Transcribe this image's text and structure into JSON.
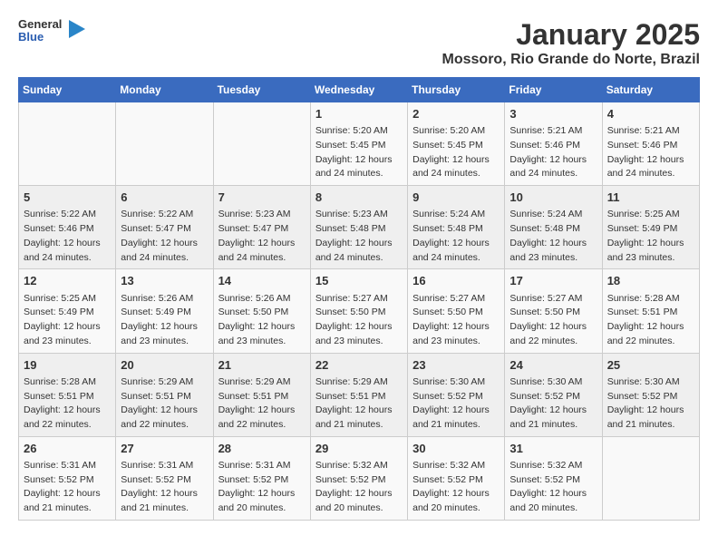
{
  "header": {
    "logo": {
      "general": "General",
      "blue": "Blue"
    },
    "title": "January 2025",
    "location": "Mossoro, Rio Grande do Norte, Brazil"
  },
  "days_of_week": [
    "Sunday",
    "Monday",
    "Tuesday",
    "Wednesday",
    "Thursday",
    "Friday",
    "Saturday"
  ],
  "weeks": [
    [
      {
        "day": "",
        "sunrise": "",
        "sunset": "",
        "daylight": ""
      },
      {
        "day": "",
        "sunrise": "",
        "sunset": "",
        "daylight": ""
      },
      {
        "day": "",
        "sunrise": "",
        "sunset": "",
        "daylight": ""
      },
      {
        "day": "1",
        "sunrise": "Sunrise: 5:20 AM",
        "sunset": "Sunset: 5:45 PM",
        "daylight": "Daylight: 12 hours and 24 minutes."
      },
      {
        "day": "2",
        "sunrise": "Sunrise: 5:20 AM",
        "sunset": "Sunset: 5:45 PM",
        "daylight": "Daylight: 12 hours and 24 minutes."
      },
      {
        "day": "3",
        "sunrise": "Sunrise: 5:21 AM",
        "sunset": "Sunset: 5:46 PM",
        "daylight": "Daylight: 12 hours and 24 minutes."
      },
      {
        "day": "4",
        "sunrise": "Sunrise: 5:21 AM",
        "sunset": "Sunset: 5:46 PM",
        "daylight": "Daylight: 12 hours and 24 minutes."
      }
    ],
    [
      {
        "day": "5",
        "sunrise": "Sunrise: 5:22 AM",
        "sunset": "Sunset: 5:46 PM",
        "daylight": "Daylight: 12 hours and 24 minutes."
      },
      {
        "day": "6",
        "sunrise": "Sunrise: 5:22 AM",
        "sunset": "Sunset: 5:47 PM",
        "daylight": "Daylight: 12 hours and 24 minutes."
      },
      {
        "day": "7",
        "sunrise": "Sunrise: 5:23 AM",
        "sunset": "Sunset: 5:47 PM",
        "daylight": "Daylight: 12 hours and 24 minutes."
      },
      {
        "day": "8",
        "sunrise": "Sunrise: 5:23 AM",
        "sunset": "Sunset: 5:48 PM",
        "daylight": "Daylight: 12 hours and 24 minutes."
      },
      {
        "day": "9",
        "sunrise": "Sunrise: 5:24 AM",
        "sunset": "Sunset: 5:48 PM",
        "daylight": "Daylight: 12 hours and 24 minutes."
      },
      {
        "day": "10",
        "sunrise": "Sunrise: 5:24 AM",
        "sunset": "Sunset: 5:48 PM",
        "daylight": "Daylight: 12 hours and 23 minutes."
      },
      {
        "day": "11",
        "sunrise": "Sunrise: 5:25 AM",
        "sunset": "Sunset: 5:49 PM",
        "daylight": "Daylight: 12 hours and 23 minutes."
      }
    ],
    [
      {
        "day": "12",
        "sunrise": "Sunrise: 5:25 AM",
        "sunset": "Sunset: 5:49 PM",
        "daylight": "Daylight: 12 hours and 23 minutes."
      },
      {
        "day": "13",
        "sunrise": "Sunrise: 5:26 AM",
        "sunset": "Sunset: 5:49 PM",
        "daylight": "Daylight: 12 hours and 23 minutes."
      },
      {
        "day": "14",
        "sunrise": "Sunrise: 5:26 AM",
        "sunset": "Sunset: 5:50 PM",
        "daylight": "Daylight: 12 hours and 23 minutes."
      },
      {
        "day": "15",
        "sunrise": "Sunrise: 5:27 AM",
        "sunset": "Sunset: 5:50 PM",
        "daylight": "Daylight: 12 hours and 23 minutes."
      },
      {
        "day": "16",
        "sunrise": "Sunrise: 5:27 AM",
        "sunset": "Sunset: 5:50 PM",
        "daylight": "Daylight: 12 hours and 23 minutes."
      },
      {
        "day": "17",
        "sunrise": "Sunrise: 5:27 AM",
        "sunset": "Sunset: 5:50 PM",
        "daylight": "Daylight: 12 hours and 22 minutes."
      },
      {
        "day": "18",
        "sunrise": "Sunrise: 5:28 AM",
        "sunset": "Sunset: 5:51 PM",
        "daylight": "Daylight: 12 hours and 22 minutes."
      }
    ],
    [
      {
        "day": "19",
        "sunrise": "Sunrise: 5:28 AM",
        "sunset": "Sunset: 5:51 PM",
        "daylight": "Daylight: 12 hours and 22 minutes."
      },
      {
        "day": "20",
        "sunrise": "Sunrise: 5:29 AM",
        "sunset": "Sunset: 5:51 PM",
        "daylight": "Daylight: 12 hours and 22 minutes."
      },
      {
        "day": "21",
        "sunrise": "Sunrise: 5:29 AM",
        "sunset": "Sunset: 5:51 PM",
        "daylight": "Daylight: 12 hours and 22 minutes."
      },
      {
        "day": "22",
        "sunrise": "Sunrise: 5:29 AM",
        "sunset": "Sunset: 5:51 PM",
        "daylight": "Daylight: 12 hours and 21 minutes."
      },
      {
        "day": "23",
        "sunrise": "Sunrise: 5:30 AM",
        "sunset": "Sunset: 5:52 PM",
        "daylight": "Daylight: 12 hours and 21 minutes."
      },
      {
        "day": "24",
        "sunrise": "Sunrise: 5:30 AM",
        "sunset": "Sunset: 5:52 PM",
        "daylight": "Daylight: 12 hours and 21 minutes."
      },
      {
        "day": "25",
        "sunrise": "Sunrise: 5:30 AM",
        "sunset": "Sunset: 5:52 PM",
        "daylight": "Daylight: 12 hours and 21 minutes."
      }
    ],
    [
      {
        "day": "26",
        "sunrise": "Sunrise: 5:31 AM",
        "sunset": "Sunset: 5:52 PM",
        "daylight": "Daylight: 12 hours and 21 minutes."
      },
      {
        "day": "27",
        "sunrise": "Sunrise: 5:31 AM",
        "sunset": "Sunset: 5:52 PM",
        "daylight": "Daylight: 12 hours and 21 minutes."
      },
      {
        "day": "28",
        "sunrise": "Sunrise: 5:31 AM",
        "sunset": "Sunset: 5:52 PM",
        "daylight": "Daylight: 12 hours and 20 minutes."
      },
      {
        "day": "29",
        "sunrise": "Sunrise: 5:32 AM",
        "sunset": "Sunset: 5:52 PM",
        "daylight": "Daylight: 12 hours and 20 minutes."
      },
      {
        "day": "30",
        "sunrise": "Sunrise: 5:32 AM",
        "sunset": "Sunset: 5:52 PM",
        "daylight": "Daylight: 12 hours and 20 minutes."
      },
      {
        "day": "31",
        "sunrise": "Sunrise: 5:32 AM",
        "sunset": "Sunset: 5:52 PM",
        "daylight": "Daylight: 12 hours and 20 minutes."
      },
      {
        "day": "",
        "sunrise": "",
        "sunset": "",
        "daylight": ""
      }
    ]
  ]
}
